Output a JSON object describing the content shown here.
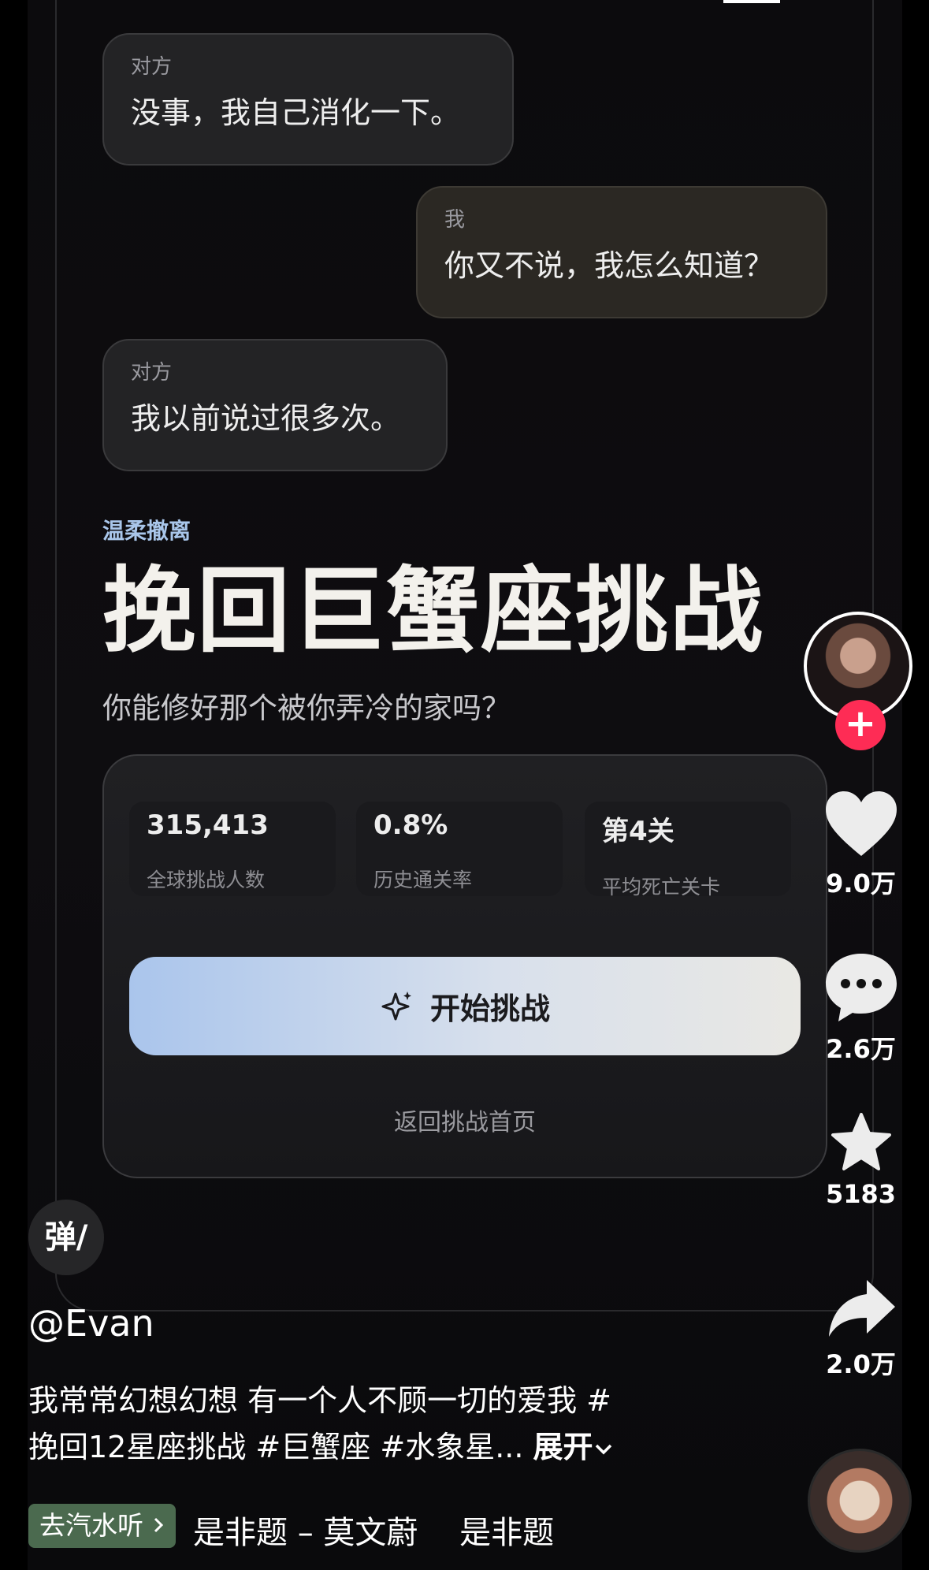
{
  "chat": [
    {
      "who": "对方",
      "msg": "没事，我自己消化一下。"
    },
    {
      "who": "我",
      "msg": "你又不说，我怎么知道？"
    },
    {
      "who": "对方",
      "msg": "我以前说过很多次。"
    }
  ],
  "challenge": {
    "tag": "温柔撤离",
    "title": "挽回巨蟹座挑战",
    "subtitle": "你能修好那个被你弄冷的家吗？",
    "stats": [
      {
        "value": "315,413",
        "label": "全球挑战人数"
      },
      {
        "value": "0.8%",
        "label": "历史通关率"
      },
      {
        "value": "第4关",
        "label": "平均死亡关卡"
      }
    ],
    "start_label": "开始挑战",
    "back_label": "返回挑战首页"
  },
  "rail": {
    "follow_symbol": "+",
    "likes": "9.0万",
    "comments": "2.6万",
    "favorites": "5183",
    "shares": "2.0万"
  },
  "post": {
    "danmu_label": "弹",
    "author": "@Evan",
    "caption_line1": "我常常幻想幻想 有一个人不顾一切的爱我 #",
    "caption_line2": "挽回12星座挑战 #巨蟹座 #水象星...",
    "expand_label": "展开",
    "music_chip": "去汽水听",
    "music_title": "是非题 – 莫文蔚　 是非题"
  },
  "colors": {
    "accent_tag": "#a9c6ea",
    "follow_red": "#fe2c55",
    "button_start": "#aac5ec"
  }
}
